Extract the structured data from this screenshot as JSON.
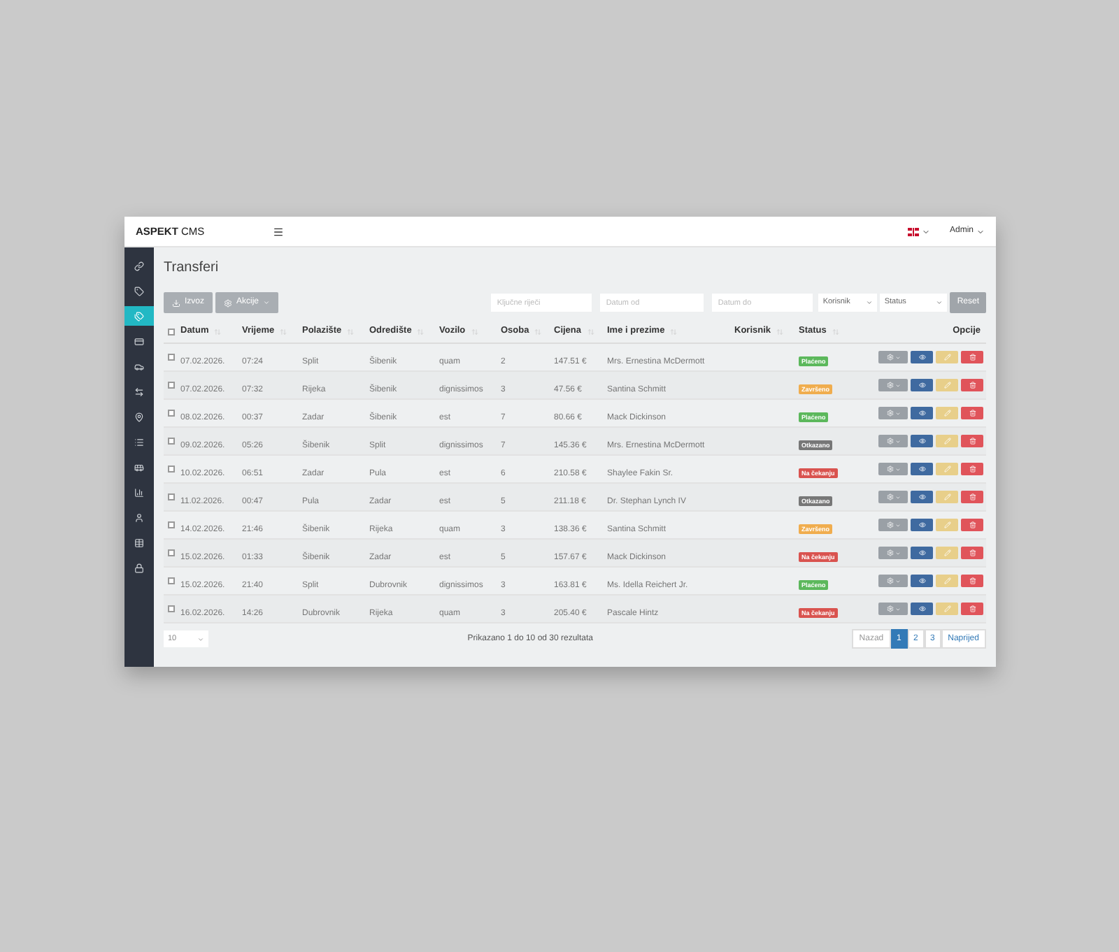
{
  "header": {
    "brand_bold": "ASPEKT",
    "brand_light": "CMS",
    "user": "Admin"
  },
  "sidebar": {
    "items": [
      {
        "selected": false
      },
      {
        "selected": false
      },
      {
        "selected": true
      },
      {
        "selected": false
      },
      {
        "selected": false
      },
      {
        "selected": false
      },
      {
        "selected": false
      },
      {
        "selected": false
      },
      {
        "selected": false
      },
      {
        "selected": false
      },
      {
        "selected": false
      },
      {
        "selected": false
      },
      {
        "selected": false
      }
    ]
  },
  "page_title": "Transferi",
  "toolbar": {
    "export": "Izvoz",
    "actions": "Akcije",
    "keywords_placeholder": "Ključne riječi",
    "date_from_placeholder": "Datum od",
    "date_to_placeholder": "Datum do",
    "user_select": "Korisnik",
    "status_select": "Status",
    "reset": "Reset"
  },
  "table": {
    "all_checked": false,
    "columns": [
      {
        "label": "Datum",
        "sortable": true
      },
      {
        "label": "Vrijeme",
        "sortable": true
      },
      {
        "label": "Polazište",
        "sortable": true
      },
      {
        "label": "Odredište",
        "sortable": true
      },
      {
        "label": "Vozilo",
        "sortable": true
      },
      {
        "label": "Osoba",
        "sortable": true
      },
      {
        "label": "Cijena",
        "sortable": true
      },
      {
        "label": "Ime i prezime",
        "sortable": true
      },
      {
        "label": "Korisnik",
        "sortable": true
      },
      {
        "label": "Status",
        "sortable": true
      },
      {
        "label": "Opcije",
        "sortable": false
      }
    ],
    "rows": [
      {
        "checked": false,
        "cells": [
          "07.02.2026.",
          "07:24",
          "Split",
          "Šibenik",
          "quam",
          "2",
          "147.51 €",
          "Mrs. Ernestina McDermott"
        ],
        "status": {
          "text": "Plaćeno",
          "kind": "paid"
        }
      },
      {
        "checked": false,
        "cells": [
          "07.02.2026.",
          "07:32",
          "Rijeka",
          "Šibenik",
          "dignissimos",
          "3",
          "47.56 €",
          "Santina Schmitt"
        ],
        "status": {
          "text": "Završeno",
          "kind": "done"
        }
      },
      {
        "checked": false,
        "cells": [
          "08.02.2026.",
          "00:37",
          "Zadar",
          "Šibenik",
          "est",
          "7",
          "80.66 €",
          "Mack Dickinson"
        ],
        "status": {
          "text": "Plaćeno",
          "kind": "paid"
        }
      },
      {
        "checked": false,
        "cells": [
          "09.02.2026.",
          "05:26",
          "Šibenik",
          "Split",
          "dignissimos",
          "7",
          "145.36 €",
          "Mrs. Ernestina McDermott"
        ],
        "status": {
          "text": "Otkazano",
          "kind": "cancelled"
        }
      },
      {
        "checked": false,
        "cells": [
          "10.02.2026.",
          "06:51",
          "Zadar",
          "Pula",
          "est",
          "6",
          "210.58 €",
          "Shaylee Fakin Sr."
        ],
        "status": {
          "text": "Na čekanju",
          "kind": "pending"
        }
      },
      {
        "checked": false,
        "cells": [
          "11.02.2026.",
          "00:47",
          "Pula",
          "Zadar",
          "est",
          "5",
          "211.18 €",
          "Dr. Stephan Lynch IV"
        ],
        "status": {
          "text": "Otkazano",
          "kind": "cancelled"
        }
      },
      {
        "checked": false,
        "cells": [
          "14.02.2026.",
          "21:46",
          "Šibenik",
          "Rijeka",
          "quam",
          "3",
          "138.36 €",
          "Santina Schmitt"
        ],
        "status": {
          "text": "Završeno",
          "kind": "done"
        }
      },
      {
        "checked": false,
        "cells": [
          "15.02.2026.",
          "01:33",
          "Šibenik",
          "Zadar",
          "est",
          "5",
          "157.67 €",
          "Mack Dickinson"
        ],
        "status": {
          "text": "Na čekanju",
          "kind": "pending"
        }
      },
      {
        "checked": false,
        "cells": [
          "15.02.2026.",
          "21:40",
          "Split",
          "Dubrovnik",
          "dignissimos",
          "3",
          "163.81 €",
          "Ms. Idella Reichert Jr."
        ],
        "status": {
          "text": "Plaćeno",
          "kind": "paid"
        }
      },
      {
        "checked": false,
        "cells": [
          "16.02.2026.",
          "14:26",
          "Dubrovnik",
          "Rijeka",
          "quam",
          "3",
          "205.40 €",
          "Pascale Hintz"
        ],
        "status": {
          "text": "Na čekanju",
          "kind": "pending"
        }
      }
    ]
  },
  "footer": {
    "page_size": "10",
    "summary": "Prikazano 1 do 10 od 30 rezultata",
    "prev": "Nazad",
    "next": "Naprijed",
    "pages": [
      {
        "label": "1",
        "selected": true
      },
      {
        "label": "2",
        "selected": false
      },
      {
        "label": "3",
        "selected": false
      }
    ]
  }
}
